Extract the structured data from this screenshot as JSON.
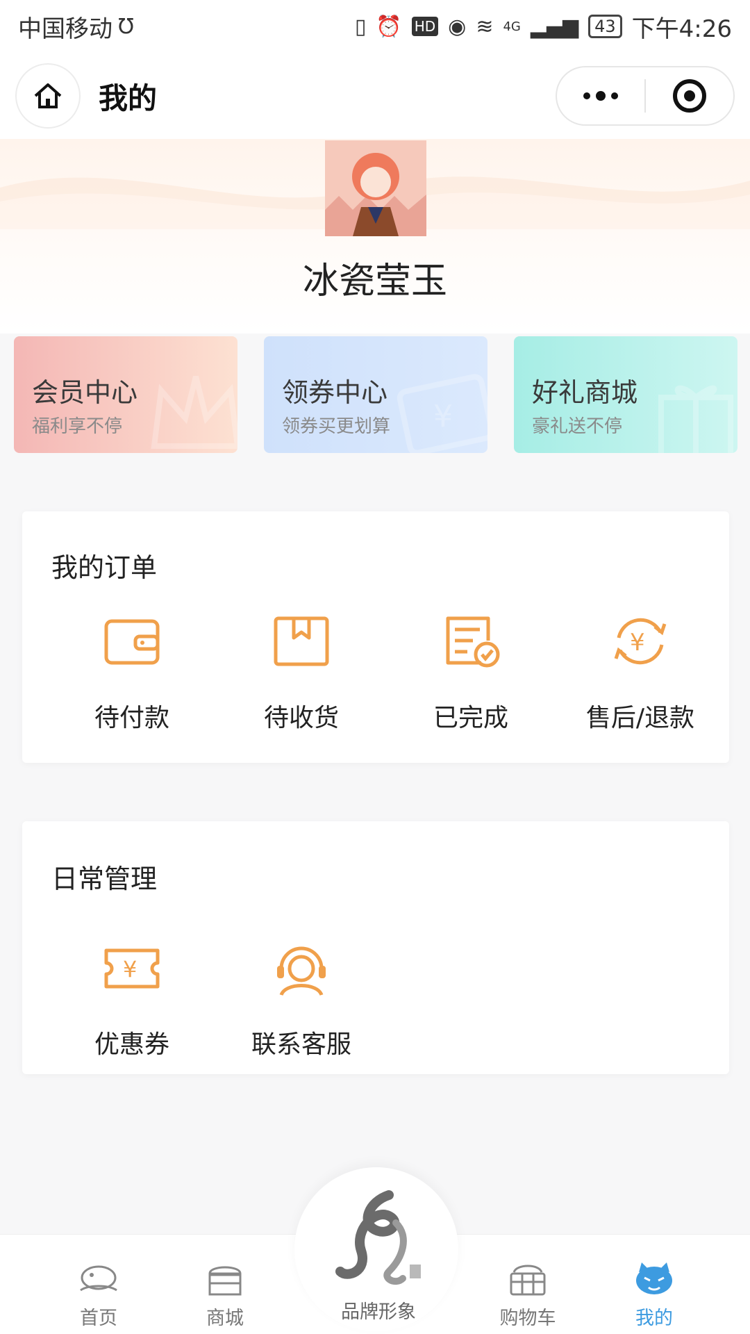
{
  "status_bar": {
    "carrier": "中国移动",
    "network": "4G",
    "battery": "43",
    "time": "下午4:26"
  },
  "nav": {
    "title": "我的"
  },
  "profile": {
    "username": "冰瓷莹玉"
  },
  "promos": [
    {
      "title": "会员中心",
      "subtitle": "福利享不停"
    },
    {
      "title": "领券中心",
      "subtitle": "领券买更划算"
    },
    {
      "title": "好礼商城",
      "subtitle": "豪礼送不停"
    }
  ],
  "orders": {
    "title": "我的订单",
    "items": [
      {
        "label": "待付款",
        "icon": "wallet-icon"
      },
      {
        "label": "待收货",
        "icon": "package-icon"
      },
      {
        "label": "已完成",
        "icon": "completed-list-icon"
      },
      {
        "label": "售后/退款",
        "icon": "refund-icon"
      }
    ]
  },
  "daily": {
    "title": "日常管理",
    "items": [
      {
        "label": "优惠券",
        "icon": "coupon-icon"
      },
      {
        "label": "联系客服",
        "icon": "customer-service-icon"
      }
    ]
  },
  "tabbar": {
    "items": [
      {
        "label": "首页",
        "icon": "fish-home-icon"
      },
      {
        "label": "商城",
        "icon": "shop-icon"
      },
      {
        "label": "品牌形象",
        "icon": "brand-logo-icon"
      },
      {
        "label": "购物车",
        "icon": "basket-icon"
      },
      {
        "label": "我的",
        "icon": "cat-profile-icon"
      }
    ],
    "active_index": 4
  },
  "colors": {
    "accent_orange": "#f0a04b",
    "tab_active": "#3d9be0",
    "tab_inactive": "#777777"
  }
}
